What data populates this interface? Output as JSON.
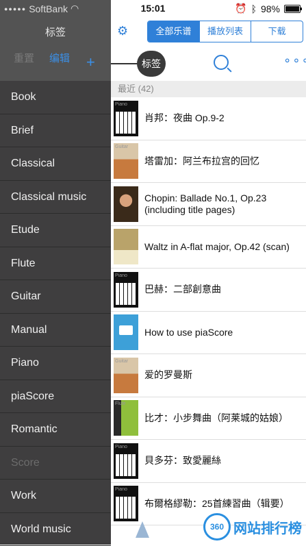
{
  "status": {
    "carrier": "SoftBank",
    "time": "15:01",
    "battery": "98%",
    "battery_level": 0.98
  },
  "sidebar": {
    "title": "标签",
    "reset": "重置",
    "edit": "编辑",
    "add": "+",
    "tags": [
      "Book",
      "Brief",
      "Classical",
      "Classical music",
      "Etude",
      "Flute",
      "Guitar",
      "Manual",
      "Piano",
      "piaScore",
      "Romantic",
      "Score",
      "Work",
      "World music"
    ]
  },
  "tag_bubble": "标签",
  "toolbar": {
    "tabs": [
      "全部乐谱",
      "播放列表",
      "下载"
    ]
  },
  "section": {
    "label": "最近 (42)"
  },
  "scores": [
    {
      "title": "肖邦：夜曲 Op.9-2",
      "thumb": "piano",
      "thumb_label": "Piano"
    },
    {
      "title": "塔雷加：阿兰布拉宫的回忆",
      "thumb": "guitar",
      "thumb_label": "Guitar"
    },
    {
      "title": "Chopin: Ballade No.1, Op.23 (including title pages)",
      "thumb": "portrait",
      "thumb_label": ""
    },
    {
      "title": "Waltz in A-flat major, Op.42 (scan)",
      "thumb": "waltz",
      "thumb_label": ""
    },
    {
      "title": "巴赫：二部創意曲",
      "thumb": "piano",
      "thumb_label": "Piano"
    },
    {
      "title": "How to use piaScore",
      "thumb": "app",
      "thumb_label": ""
    },
    {
      "title": "爱的罗曼斯",
      "thumb": "guitar",
      "thumb_label": "Guitar"
    },
    {
      "title": "比才：小步舞曲（阿莱城的姑娘）",
      "thumb": "flute",
      "thumb_label": "Flute"
    },
    {
      "title": "貝多芬：致愛麗絲",
      "thumb": "piano",
      "thumb_label": "Piano"
    },
    {
      "title": "布爾格繆勒：25首練習曲（辑要）",
      "thumb": "piano",
      "thumb_label": "Piano"
    }
  ],
  "watermark": {
    "logo": "360",
    "text": "网站排行榜"
  }
}
